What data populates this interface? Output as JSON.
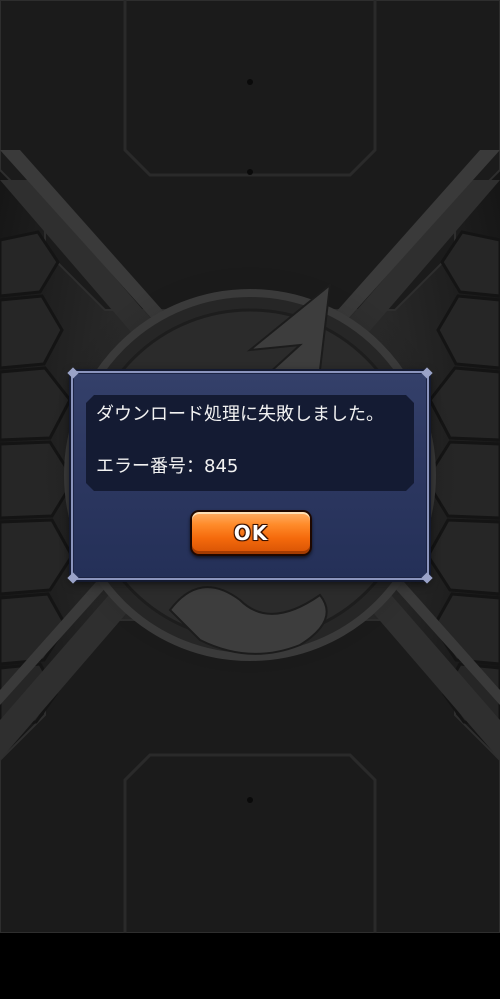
{
  "dialog": {
    "message": "ダウンロード処理に失敗しました。",
    "error_label": "エラー番号：845",
    "ok_label": "OK"
  },
  "colors": {
    "dialog_background": "#2c3760",
    "dialog_border": "#8b95bd",
    "message_panel": "#141b33",
    "button_orange": "#f56a0c",
    "text": "#f2f2f2"
  },
  "icons": {
    "background_emblem": "winged-emblem-icon"
  }
}
